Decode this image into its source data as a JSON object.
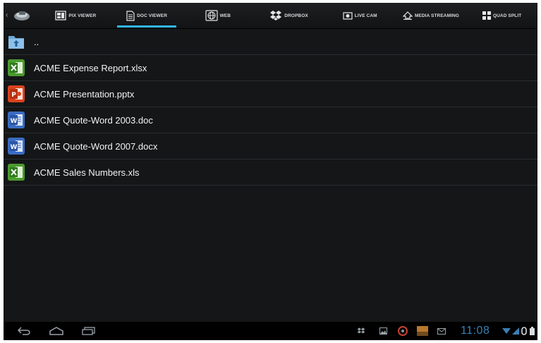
{
  "tabs": [
    {
      "label": "PIX VIEWER",
      "icon": "image-viewer-icon"
    },
    {
      "label": "DOC VIEWER",
      "icon": "document-icon"
    },
    {
      "label": "WEB",
      "icon": "globe-icon"
    },
    {
      "label": "DROPBOX",
      "icon": "dropbox-icon"
    },
    {
      "label": "LIVE CAM",
      "icon": "camera-icon"
    },
    {
      "label": "MEDIA STREAMING",
      "icon": "media-streaming-icon"
    },
    {
      "label": "QUAD SPLIT",
      "icon": "quad-split-icon"
    }
  ],
  "active_tab": "DOC VIEWER",
  "files": [
    {
      "name": "..",
      "type": "parent-folder"
    },
    {
      "name": "ACME Expense Report.xlsx",
      "type": "excel"
    },
    {
      "name": "ACME Presentation.pptx",
      "type": "powerpoint"
    },
    {
      "name": "ACME Quote-Word 2003.doc",
      "type": "word"
    },
    {
      "name": "ACME Quote-Word 2007.docx",
      "type": "word"
    },
    {
      "name": "ACME Sales Numbers.xls",
      "type": "excel"
    }
  ],
  "status": {
    "time": "11:08"
  },
  "colors": {
    "accent": "#33b5e5",
    "clock": "#3b7fb3",
    "background": "#141617",
    "excel": "#4a9b2e",
    "powerpoint": "#d9431e",
    "word": "#3a6cc4"
  }
}
